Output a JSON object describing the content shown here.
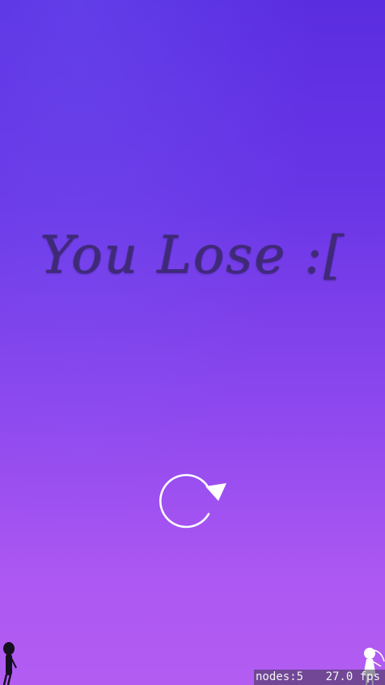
{
  "game": {
    "title": "You Lose :[",
    "restart_icon": "restart-icon",
    "characters": [
      "boy-silhouette-icon",
      "girl-silhouette-icon"
    ],
    "colors": {
      "background_top": "#5a2de0",
      "background_bottom": "#b25cf2",
      "title_text": "#3f2a78",
      "restart_icon": "#ffffff"
    }
  },
  "debug": {
    "nodes": "nodes:5",
    "fps": "27.0 fps"
  }
}
